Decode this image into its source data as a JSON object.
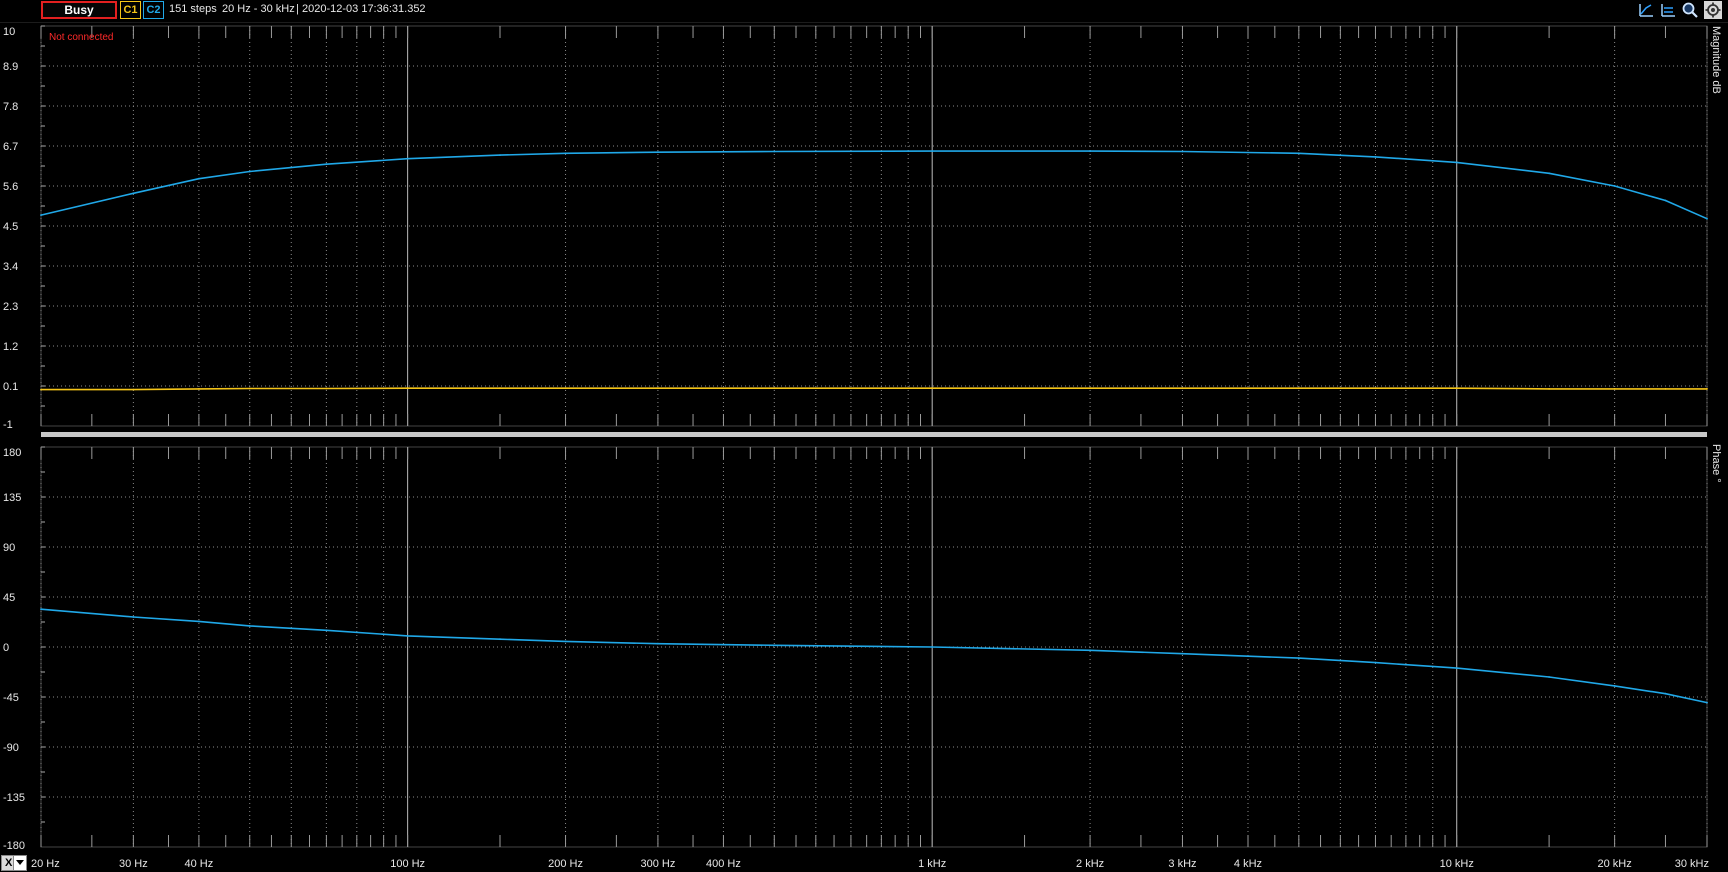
{
  "toolbar": {
    "status": "Busy",
    "channel1": "C1",
    "channel2": "C2",
    "steps": "151 steps",
    "range": "20 Hz - 30 kHz",
    "separator": "|",
    "timestamp": "2020-12-03 17:36:31.352",
    "icons": [
      "cursor-a-icon",
      "cursor-b-icon",
      "zoom-icon",
      "settings-icon"
    ]
  },
  "x_axis_selector": {
    "label": "X"
  },
  "colors": {
    "status_border": "#e32020",
    "channel1": "#f5c518",
    "channel2": "#20a8e8",
    "warning": "#ff2a2a"
  },
  "chart_data": [
    {
      "type": "line",
      "xscale": "log",
      "ylabel": "Magnitude dB",
      "annotation": "Not connected",
      "xlim": [
        20,
        30000
      ],
      "ylim": [
        -1,
        10
      ],
      "ytick_labels": [
        "10",
        "8.9",
        "7.8",
        "6.7",
        "5.6",
        "4.5",
        "3.4",
        "2.3",
        "1.2",
        "0.1",
        "-1"
      ],
      "grid": true,
      "x": [
        20,
        30,
        40,
        50,
        70,
        100,
        150,
        200,
        300,
        500,
        1000,
        2000,
        3000,
        5000,
        7000,
        10000,
        15000,
        20000,
        25000,
        30000
      ],
      "series": [
        {
          "name": "C1",
          "color": "#f5c518",
          "values": [
            0.0,
            0.0,
            0.02,
            0.03,
            0.03,
            0.04,
            0.04,
            0.04,
            0.04,
            0.04,
            0.04,
            0.04,
            0.04,
            0.04,
            0.04,
            0.04,
            0.02,
            0.02,
            0.02,
            0.02
          ]
        },
        {
          "name": "C2",
          "color": "#20a8e8",
          "values": [
            4.8,
            5.4,
            5.8,
            6.0,
            6.2,
            6.35,
            6.45,
            6.5,
            6.53,
            6.55,
            6.56,
            6.56,
            6.55,
            6.5,
            6.4,
            6.25,
            5.95,
            5.6,
            5.2,
            4.7
          ]
        }
      ]
    },
    {
      "type": "line",
      "xscale": "log",
      "xlabel": "",
      "ylabel": "Phase °",
      "xlim": [
        20,
        30000
      ],
      "ylim": [
        -180,
        180
      ],
      "ytick_labels": [
        "180",
        "135",
        "90",
        "45",
        "0",
        "-45",
        "-90",
        "-135",
        "-180"
      ],
      "xtick_labels": [
        "20 Hz",
        "30 Hz",
        "40 Hz",
        "100 Hz",
        "200 Hz",
        "300 Hz",
        "400 Hz",
        "1 kHz",
        "2 kHz",
        "3 kHz",
        "4 kHz",
        "10 kHz",
        "20 kHz",
        "30 kHz"
      ],
      "xtick_values": [
        20,
        30,
        40,
        100,
        200,
        300,
        400,
        1000,
        2000,
        3000,
        4000,
        10000,
        20000,
        30000
      ],
      "grid": true,
      "x": [
        20,
        30,
        40,
        50,
        70,
        100,
        150,
        200,
        300,
        500,
        1000,
        2000,
        3000,
        5000,
        7000,
        10000,
        15000,
        20000,
        25000,
        30000
      ],
      "series": [
        {
          "name": "C2",
          "color": "#20a8e8",
          "values": [
            34,
            27,
            23,
            19,
            15,
            10,
            7,
            5,
            3,
            1.5,
            0,
            -3,
            -6,
            -10,
            -14,
            -19,
            -27,
            -35,
            -42,
            -50
          ]
        }
      ]
    }
  ]
}
